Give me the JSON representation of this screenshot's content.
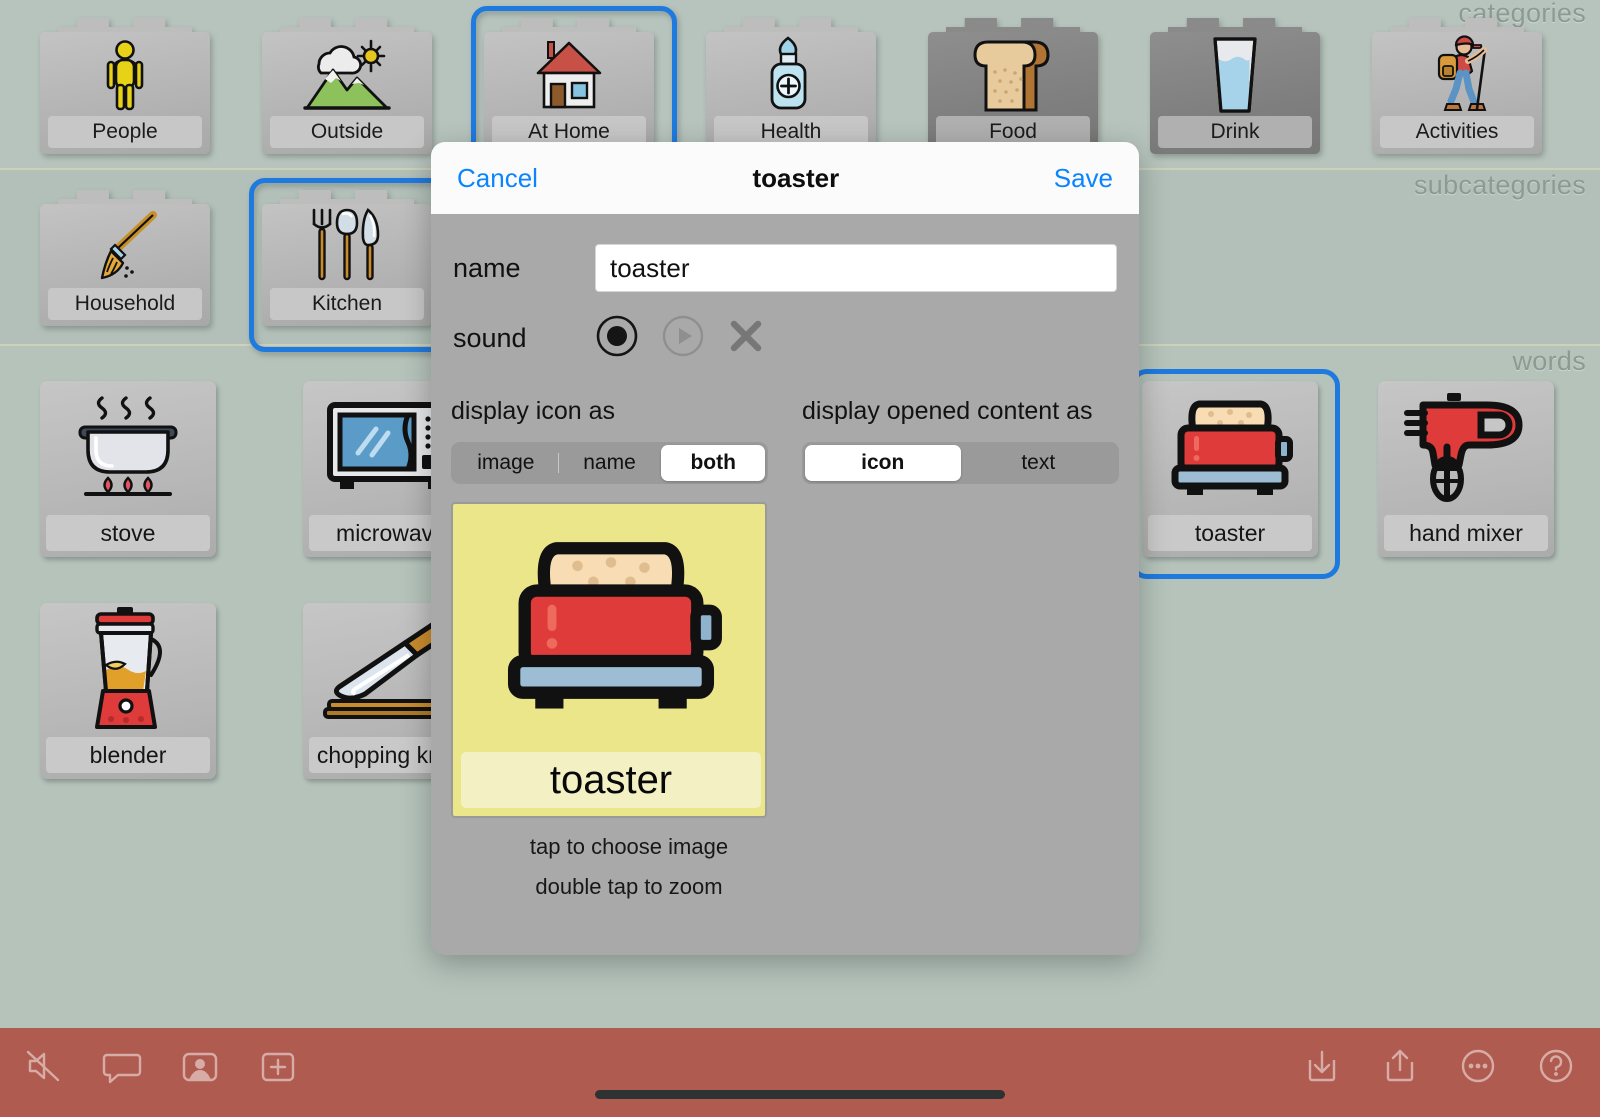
{
  "bands": {
    "categories_label": "categories",
    "subcategories_label": "subcategories",
    "words_label": "words"
  },
  "categories": [
    {
      "label": "People",
      "icon": "person-icon",
      "selected": false,
      "dark": false
    },
    {
      "label": "Outside",
      "icon": "weather-mountain-icon",
      "selected": false,
      "dark": false
    },
    {
      "label": "At Home",
      "icon": "house-icon",
      "selected": true,
      "dark": false
    },
    {
      "label": "Health",
      "icon": "medicine-bottle-icon",
      "selected": false,
      "dark": false
    },
    {
      "label": "Food",
      "icon": "bread-icon",
      "selected": false,
      "dark": true
    },
    {
      "label": "Drink",
      "icon": "water-glass-icon",
      "selected": false,
      "dark": true
    },
    {
      "label": "Activities",
      "icon": "hiker-icon",
      "selected": false,
      "dark": false
    }
  ],
  "subcategories": [
    {
      "label": "Household",
      "icon": "broom-icon",
      "selected": false
    },
    {
      "label": "Kitchen",
      "icon": "cutlery-icon",
      "selected": true
    }
  ],
  "words": [
    {
      "label": "stove",
      "icon": "stove-icon",
      "selected": false
    },
    {
      "label": "microwave",
      "icon": "microwave-icon",
      "selected": false
    },
    {
      "label": "toaster",
      "icon": "toaster-icon",
      "selected": true
    },
    {
      "label": "hand mixer",
      "icon": "hand-mixer-icon",
      "selected": false
    },
    {
      "label": "blender",
      "icon": "blender-icon",
      "selected": false
    },
    {
      "label": "chopping knife",
      "icon": "chopping-knife-icon",
      "selected": false
    }
  ],
  "modal": {
    "cancel_label": "Cancel",
    "title": "toaster",
    "save_label": "Save",
    "name_label": "name",
    "name_value": "toaster",
    "name_placeholder": "name",
    "sound_label": "sound",
    "sound_icons": [
      "record-icon",
      "play-icon",
      "clear-icon"
    ],
    "display_icon_as": {
      "heading": "display icon as",
      "options": [
        "image",
        "name",
        "both"
      ],
      "selected": "both"
    },
    "display_opened_content_as": {
      "heading": "display opened content as",
      "options": [
        "icon",
        "text"
      ],
      "selected": "icon"
    },
    "preview": {
      "label": "toaster",
      "image": "toaster-icon",
      "background_color": "#ebe68a",
      "label_background_color": "#f3f0c4"
    },
    "hint_line1": "tap to choose image",
    "hint_line2": "double tap to zoom"
  },
  "toolbar": {
    "background_color": "#b05b50",
    "left_icons": [
      "mute-icon",
      "speech-bubble-icon",
      "user-photo-icon",
      "add-box-icon"
    ],
    "right_icons": [
      "download-icon",
      "share-icon",
      "more-icon",
      "help-icon"
    ]
  },
  "colors": {
    "accent_blue": "#1f7ae0",
    "link_blue": "#0a84ff",
    "background": "#b4c2bb",
    "modal_background": "#a9a9a9",
    "tile_grey": "#b6b6b6"
  }
}
